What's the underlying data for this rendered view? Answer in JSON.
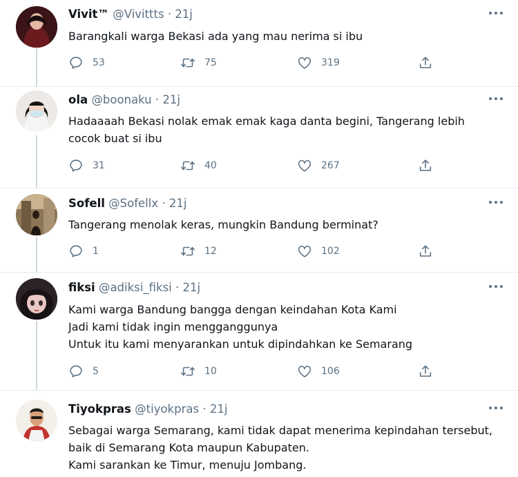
{
  "tweets": [
    {
      "name": "Vivit™",
      "handle": "@Vivittts",
      "time": "21j",
      "lines": [
        "Barangkali warga Bekasi ada yang mau nerima si ibu"
      ],
      "replies": "53",
      "retweets": "75",
      "likes": "319",
      "avatar_bg": "#3a1416"
    },
    {
      "name": "ola",
      "handle": "@boonaku",
      "time": "21j",
      "lines": [
        "Hadaaaah Bekasi nolak emak emak kaga danta begini, Tangerang lebih",
        "cocok buat si ibu"
      ],
      "replies": "31",
      "retweets": "40",
      "likes": "267",
      "avatar_bg": "#e8e4e2"
    },
    {
      "name": "Sofell",
      "handle": "@Sofellx",
      "time": "21j",
      "lines": [
        "Tangerang menolak keras, mungkin Bandung berminat?"
      ],
      "replies": "1",
      "retweets": "12",
      "likes": "102",
      "avatar_bg": "#9a8466"
    },
    {
      "name": "fiksi",
      "handle": "@adiksi_fiksi",
      "time": "21j",
      "lines": [
        "Kami warga Bandung bangga dengan keindahan Kota Kami",
        "Jadi kami tidak ingin mengganggunya",
        "Untuk itu kami menyarankan untuk dipindahkan ke Semarang"
      ],
      "replies": "5",
      "retweets": "10",
      "likes": "106",
      "avatar_bg": "#2a2226"
    },
    {
      "name": "Tiyokpras",
      "handle": "@tiyokpras",
      "time": "21j",
      "lines": [
        "Sebagai warga Semarang, kami tidak dapat menerima kepindahan tersebut,",
        "baik di Semarang Kota maupun Kabupaten.",
        "Kami sarankan ke Timur, menuju Jombang."
      ],
      "replies": "",
      "retweets": "",
      "likes": "",
      "avatar_bg": "#f2efe8"
    }
  ],
  "colors": {
    "text": "#0f1419",
    "muted": "#5b7083",
    "divider": "#e6ecf0",
    "thread": "#ccd6dd"
  }
}
